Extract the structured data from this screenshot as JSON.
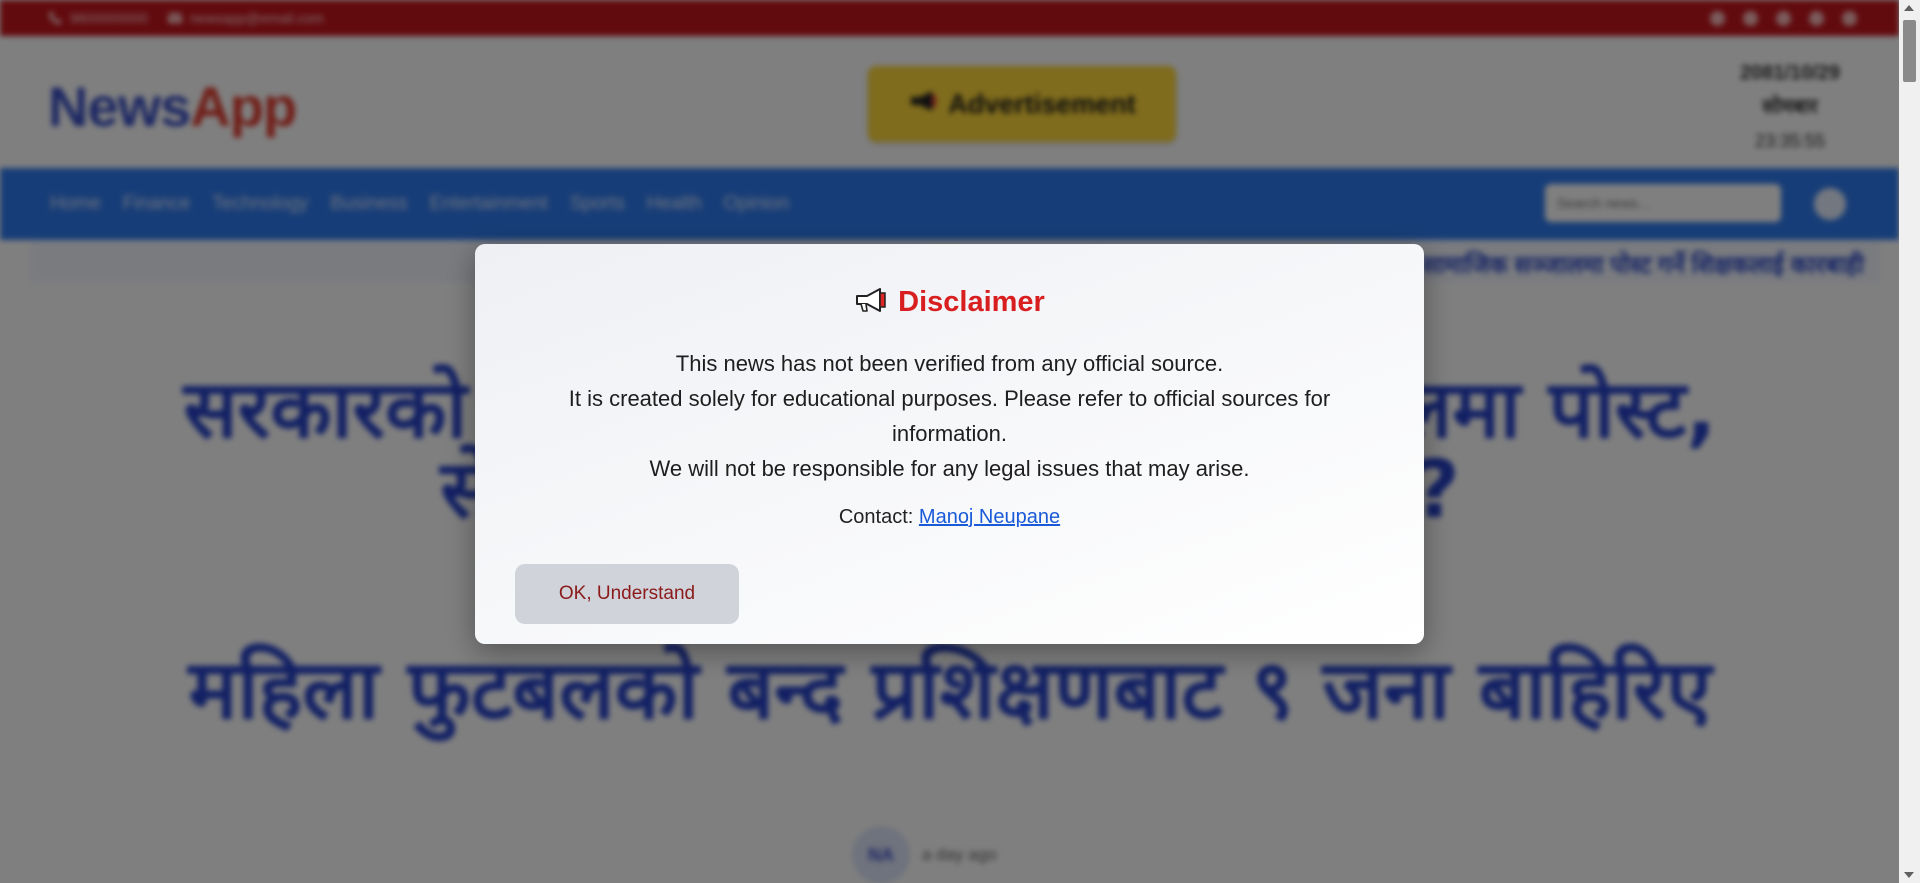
{
  "topbar": {
    "phone": "9800000000",
    "email": "newsapp@email.com",
    "social_icons": [
      "facebook-icon",
      "instagram-icon",
      "twitter-icon",
      "tiktok-icon",
      "youtube-icon"
    ]
  },
  "header": {
    "logo_part1": "News",
    "logo_part2": "App",
    "ad_label": "Advertisement",
    "date": "2081/10/29",
    "weekday": "सोमबार",
    "time": "23:35:55"
  },
  "nav": {
    "items": [
      "Home",
      "Finance",
      "Technology",
      "Business",
      "Entertainment",
      "Sports",
      "Health",
      "Opinion"
    ],
    "search_placeholder": "Search news..."
  },
  "ticker": {
    "text": "सरकारको आलोचना गर्दै सामाजिक सञ्जालमा पोस्ट गर्ने शिक्षकलाई कारबाही"
  },
  "headlines": [
    {
      "title": "सरकारको आलोचना गर्दै सामाजिक सञ्जालमा पोस्ट, सेवाबाट हटाउने कि कारबाही गर्ने ?"
    },
    {
      "title": "महिला फुटबलको बन्द प्रशिक्षणबाट ९ जना बाहिरिए",
      "author_initials": "NA",
      "time_ago": "a day ago"
    }
  ],
  "modal": {
    "title": "Disclaimer",
    "lines": [
      "This news has not been verified from any official source.",
      "It is created solely for educational purposes. Please refer to official sources for information.",
      "We will not be responsible for any legal issues that may arise."
    ],
    "contact_label": "Contact:",
    "contact_name": "Manoj Neupane",
    "ok_label": "OK, Understand"
  },
  "colors": {
    "topbar": "#c5161d",
    "nav": "#2f7bf0",
    "headline": "#2541c9",
    "disclaimer_title": "#d81e1e",
    "link": "#1a5ad8",
    "ad": "#ffd83a"
  }
}
